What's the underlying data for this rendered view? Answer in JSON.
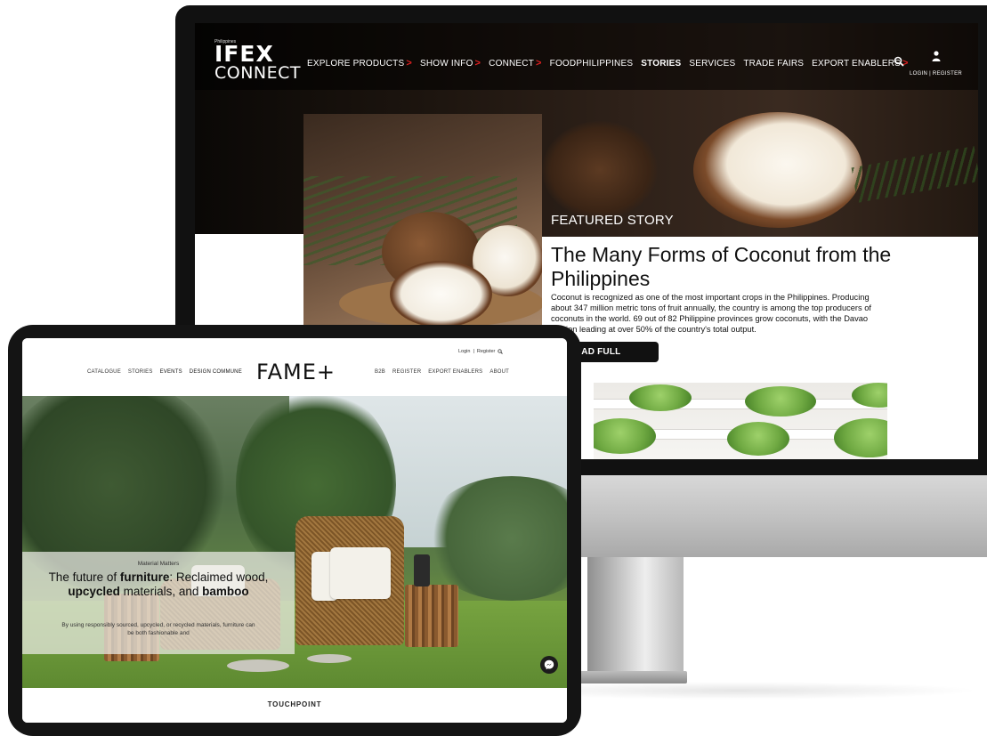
{
  "ifex": {
    "logo": {
      "small": "Philippines",
      "top": "IFEX",
      "bottom": "CONNECT"
    },
    "menu": [
      {
        "label": "EXPLORE PRODUCTS",
        "has_chevron": true
      },
      {
        "label": "SHOW INFO",
        "has_chevron": true
      },
      {
        "label": "CONNECT",
        "has_chevron": true
      },
      {
        "label": "FOODPHILIPPINES",
        "has_chevron": false
      },
      {
        "label": "STORIES",
        "has_chevron": false
      },
      {
        "label": "SERVICES",
        "has_chevron": false
      },
      {
        "label": "TRADE FAIRS",
        "has_chevron": false
      },
      {
        "label": "EXPORT ENABLERS",
        "has_chevron": true
      }
    ],
    "chevron": ">",
    "login_register": "LOGIN | REGISTER",
    "featured": {
      "label": "FEATURED STORY",
      "title": "The Many Forms of Coconut from the Philippines",
      "body": "Coconut is recognized as one of the most important crops in the Philippines. Producing about 347 million metric tons of fruit annually, the country is among the top producers of coconuts in the world. 69 out of 82 Philippine provinces grow coconuts, with the Davao Region leading at over 50% of the country's total output.",
      "button": "READ FULL ARTICLE"
    },
    "accent_color": "#e02020"
  },
  "fame": {
    "login": "Login",
    "register": "Register",
    "separator": "|",
    "left_menu": [
      "CATALOGUE",
      "STORIES",
      "EVENTS",
      "DESIGN COMMUNE"
    ],
    "logo": "FAME+",
    "right_menu": [
      "B2B",
      "REGISTER",
      "EXPORT ENABLERS",
      "ABOUT"
    ],
    "hero": {
      "kicker": "Material Matters",
      "headline_parts": [
        "The future of ",
        "furniture",
        ": Reclaimed wood, ",
        "upcycled",
        " materials, and ",
        "bamboo"
      ],
      "sub": "By using responsibly sourced, upcycled, or recycled materials, furniture can be both fashionable and"
    },
    "section_title": "TOUCHPOINT",
    "chat_icon": "messenger-icon"
  }
}
